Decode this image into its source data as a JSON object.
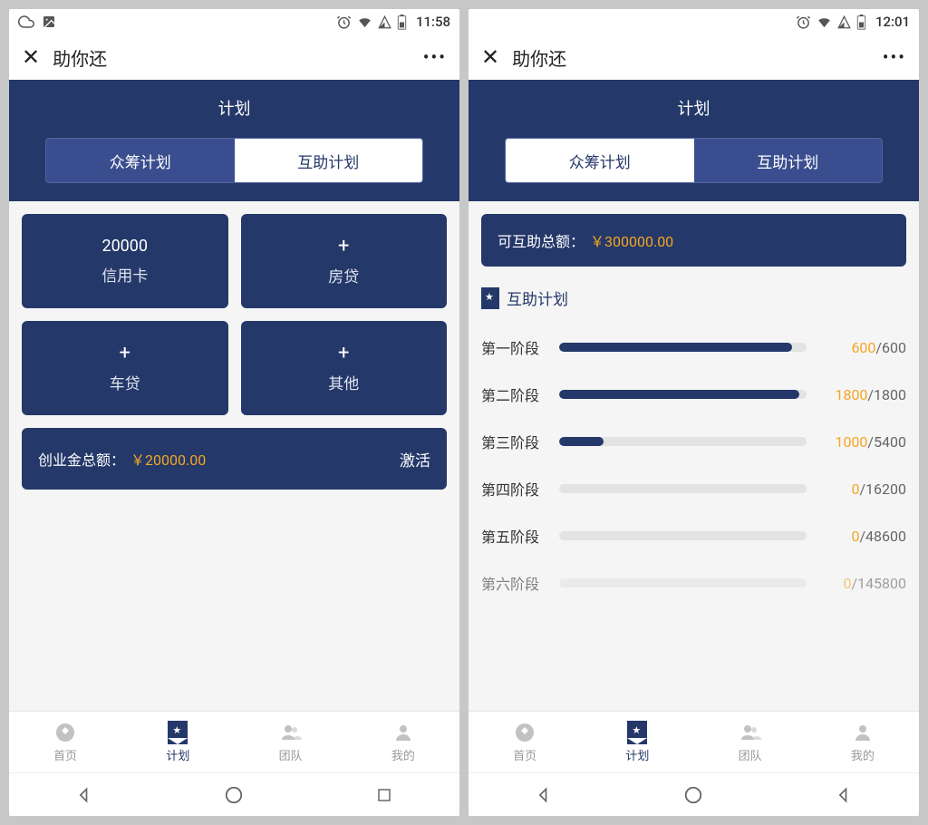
{
  "left": {
    "statusbar": {
      "time": "11:58"
    },
    "app": {
      "title": "助你还"
    },
    "plan": {
      "title": "计划",
      "tab1": "众筹计划",
      "tab2": "互助计划"
    },
    "cards": [
      {
        "value": "20000",
        "label": "信用卡",
        "hasPlus": false
      },
      {
        "value": "",
        "label": "房贷",
        "hasPlus": true
      },
      {
        "value": "",
        "label": "车贷",
        "hasPlus": true
      },
      {
        "value": "",
        "label": "其他",
        "hasPlus": true
      }
    ],
    "total": {
      "label": "创业金总额：",
      "amount": "￥20000.00",
      "action": "激活"
    },
    "nav": [
      {
        "label": "首页",
        "active": false
      },
      {
        "label": "计划",
        "active": true
      },
      {
        "label": "团队",
        "active": false
      },
      {
        "label": "我的",
        "active": false
      }
    ]
  },
  "right": {
    "statusbar": {
      "time": "12:01"
    },
    "app": {
      "title": "助你还"
    },
    "plan": {
      "title": "计划",
      "tab1": "众筹计划",
      "tab2": "互助计划"
    },
    "mutual": {
      "label": "可互助总额：",
      "amount": "￥300000.00"
    },
    "section": {
      "title": "互助计划"
    },
    "stages": [
      {
        "name": "第一阶段",
        "current": "600",
        "total": "/600",
        "pct": 100
      },
      {
        "name": "第二阶段",
        "current": "1800",
        "total": "/1800",
        "pct": 100
      },
      {
        "name": "第三阶段",
        "current": "1000",
        "total": "/5400",
        "pct": 18
      },
      {
        "name": "第四阶段",
        "current": "0",
        "total": "/16200",
        "pct": 0
      },
      {
        "name": "第五阶段",
        "current": "0",
        "total": "/48600",
        "pct": 0
      },
      {
        "name": "第六阶段",
        "current": "0",
        "total": "/145800",
        "pct": 0
      }
    ],
    "nav": [
      {
        "label": "首页",
        "active": false
      },
      {
        "label": "计划",
        "active": true
      },
      {
        "label": "团队",
        "active": false
      },
      {
        "label": "我的",
        "active": false
      }
    ]
  }
}
